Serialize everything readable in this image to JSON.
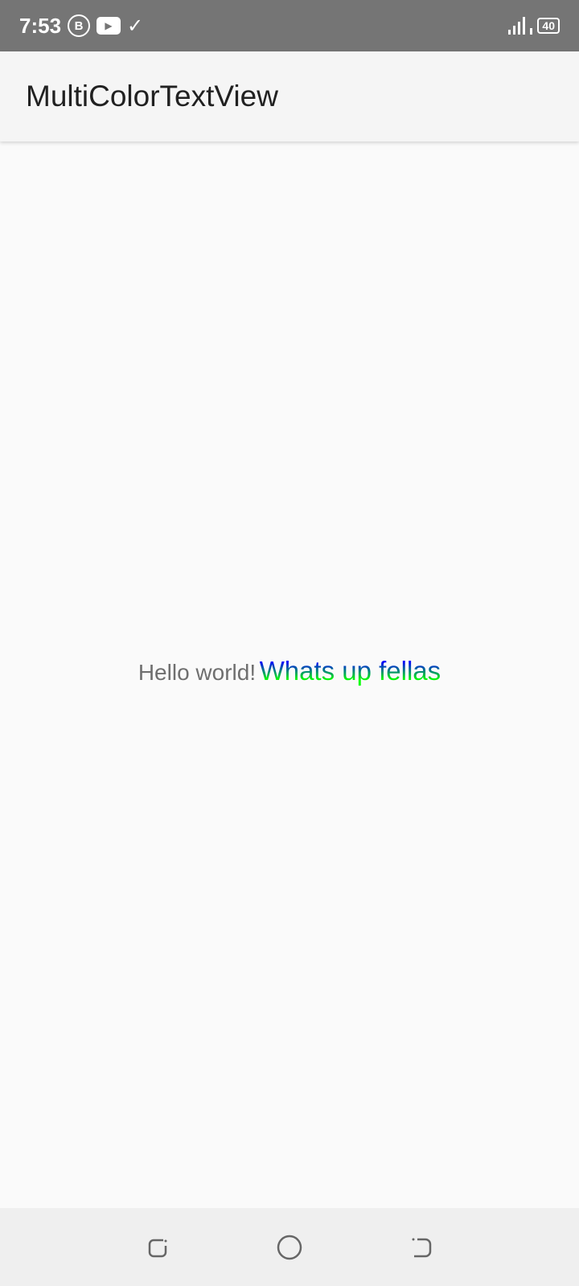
{
  "status_bar": {
    "time": "7:53",
    "icons": [
      "whatsapp-business-icon",
      "youtube-icon",
      "check-icon"
    ],
    "battery": "40"
  },
  "app_bar": {
    "title": "MultiColorTextView"
  },
  "content": {
    "plain_text": "Hello world!",
    "gradient_text": "Whats up fellas",
    "gradient_colors": [
      "#0000ff",
      "#00ff00"
    ]
  },
  "nav_bar": {
    "buttons": [
      "recents",
      "home",
      "back"
    ]
  }
}
